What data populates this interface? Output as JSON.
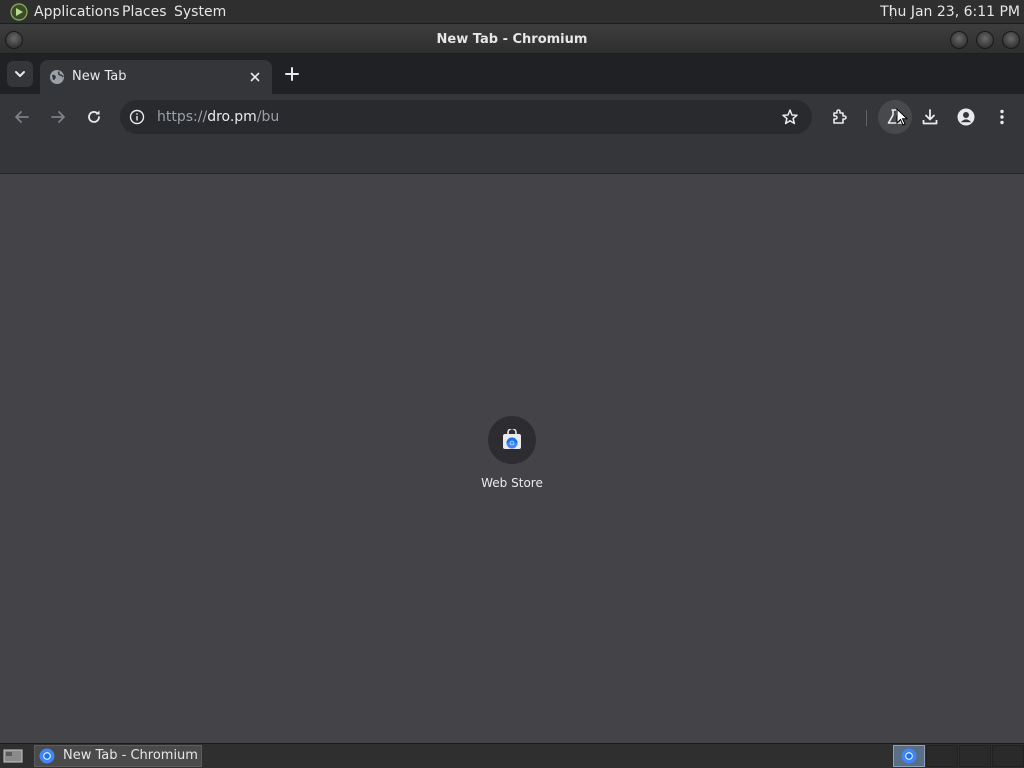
{
  "top_panel": {
    "menus": [
      "Applications",
      "Places",
      "System"
    ],
    "clock": "Thu Jan 23,  6:11 PM"
  },
  "window": {
    "title": "New Tab - Chromium"
  },
  "tabs": [
    {
      "title": "New Tab",
      "active": true
    }
  ],
  "toolbar": {
    "url_prefix": "https://",
    "url_host": "dro.pm",
    "url_path": "/bu"
  },
  "content": {
    "shortcuts": [
      {
        "label": "Web Store",
        "icon": "webstore-icon"
      }
    ]
  },
  "taskbar": {
    "task_label": "New Tab - Chromium",
    "workspaces": 4
  },
  "colors": {
    "page_bg": "#434348",
    "toolbar_bg": "#35363a",
    "tabstrip_bg": "#202124",
    "accent_blue": "#4285f4"
  }
}
